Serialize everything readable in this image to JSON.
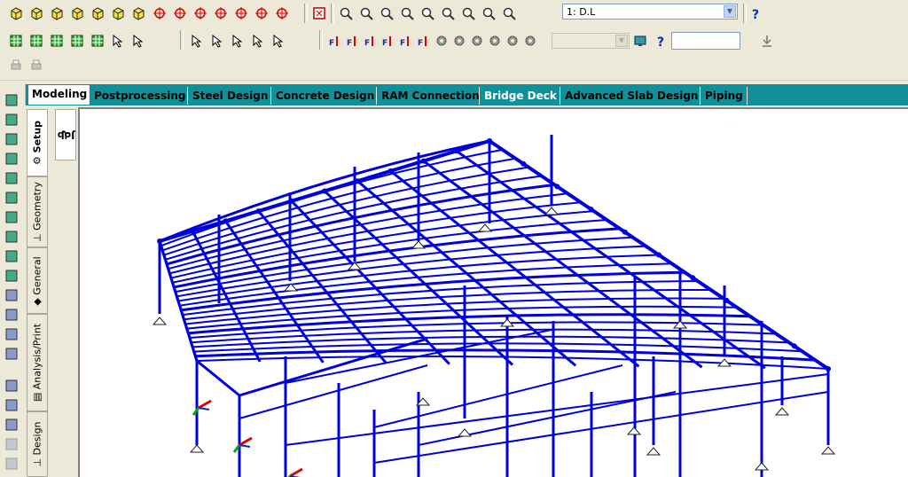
{
  "toolbar1": {
    "icons": [
      "isometric-view-icon",
      "front-view-icon",
      "back-view-icon",
      "left-view-icon",
      "right-view-icon",
      "top-view-icon",
      "bottom-view-icon",
      "rotate-up-icon",
      "rotate-down-icon",
      "rotate-left-icon",
      "rotate-right-icon",
      "spin-left-icon",
      "spin-right-icon",
      "select-rotate-icon",
      "display-box-icon",
      "zoom-in-icon",
      "zoom-out-icon",
      "zoom-window-icon",
      "dynamic-zoom-icon",
      "zoom-all-icon",
      "zoom-previous-icon",
      "pan-icon",
      "magnifier-icon",
      "zoom-extents-icon",
      "help-icon"
    ],
    "load_case": "1: D.L"
  },
  "toolbar2": {
    "icons": [
      "node-cursor-icon",
      "beam-cursor-icon",
      "plate-cursor-icon",
      "solid-cursor-icon",
      "surface-cursor-icon",
      "display-settings-icon",
      "structure-grid-icon",
      "add-member-icon",
      "link-icon",
      "insert-node-icon",
      "ruler-icon",
      "angle-icon",
      "fx-icon",
      "fy-icon",
      "fz-icon",
      "mx-icon",
      "mz-icon",
      "my-icon",
      "tag-icon",
      "shape-icon",
      "settings-icon",
      "color-icon",
      "pencil-icon",
      "chain-icon",
      "monitor-icon",
      "query-icon",
      "download-icon"
    ],
    "combo_value": "",
    "field_value": ""
  },
  "toolbar3": {
    "icons": [
      "print-icon",
      "animation-icon"
    ]
  },
  "tabs": [
    {
      "label": "Modeling",
      "active": true
    },
    {
      "label": "Postprocessing",
      "active": false
    },
    {
      "label": "Steel Design",
      "active": false
    },
    {
      "label": "Concrete Design",
      "active": false
    },
    {
      "label": "RAM Connection",
      "active": false
    },
    {
      "label": "Bridge Deck",
      "active": false
    },
    {
      "label": "Advanced Slab Design",
      "active": false
    },
    {
      "label": "Piping",
      "active": false
    }
  ],
  "side_tabs": [
    {
      "label": "Setup",
      "active": true
    },
    {
      "label": "Geometry",
      "active": false
    },
    {
      "label": "General",
      "active": false
    },
    {
      "label": "Analysis/Print",
      "active": false
    },
    {
      "label": "Design",
      "active": false
    }
  ],
  "job_tab": "Job",
  "colors": {
    "tabbar": "#11909a",
    "beam": "#0000dd",
    "axis_x": "#dd0000",
    "axis_y": "#00aa00"
  }
}
